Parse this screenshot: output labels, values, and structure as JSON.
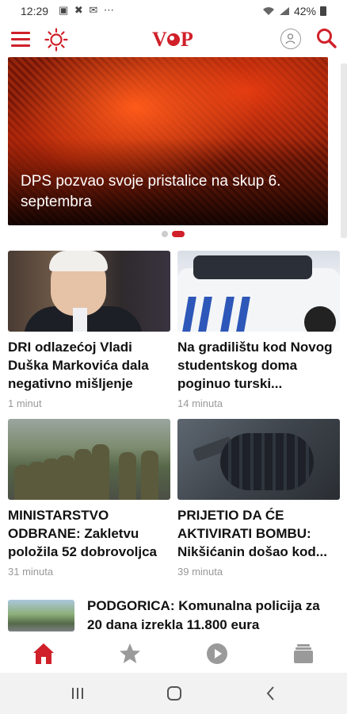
{
  "status_bar": {
    "time": "12:29",
    "notification_icons": "▣ ✖ ✉ ⋯",
    "battery": "42%"
  },
  "header": {
    "logo_text": "VOP",
    "brand_color": "#d0202a"
  },
  "hero": {
    "title": "DPS pozvao svoje pristalice na skup 6. septembra",
    "slide_count": 2,
    "active_slide": 2
  },
  "grid": [
    {
      "title": "DRI odlazećoj Vladi Duška Markovića dala negativno mišljenje",
      "time": "1 minut"
    },
    {
      "title": "Na gradilištu kod Novog studentskog doma poginuo turski...",
      "time": "14 minuta"
    },
    {
      "title": "MINISTARSTVO ODBRANE: Zakletvu položila 52 dobrovoljca",
      "time": "31 minuta"
    },
    {
      "title": "PRIJETIO DA ĆE AKTIVIRATI BOMBU: Nikšićanin došao kod...",
      "time": "39 minuta"
    }
  ],
  "list": [
    {
      "title": "PODGORICA: Komunalna policija za 20 dana izrekla 11.800 eura"
    }
  ],
  "bottom_nav": [
    {
      "icon": "home-icon",
      "active": true
    },
    {
      "icon": "star-icon",
      "active": false
    },
    {
      "icon": "play-icon",
      "active": false
    },
    {
      "icon": "stack-icon",
      "active": false
    }
  ]
}
